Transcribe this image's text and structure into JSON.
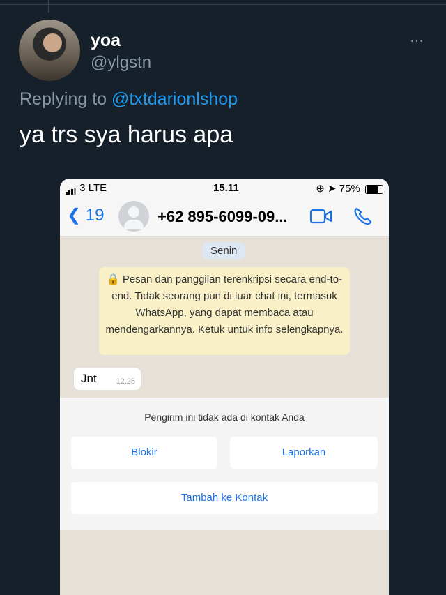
{
  "tweet": {
    "display_name": "yoa",
    "handle": "@ylgstn",
    "more_icon": "⋯",
    "replying_prefix": "Replying to",
    "replying_to": "@txtdarionlshop",
    "text": "ya trs sya harus apa"
  },
  "screenshot": {
    "status_bar": {
      "carrier": "3",
      "network": "LTE",
      "time": "15.11",
      "battery": "75%"
    },
    "header": {
      "back_count": "19",
      "contact": "+62 895-6099-09..."
    },
    "chat": {
      "day_label": "Senin",
      "encryption_notice": "Pesan dan panggilan terenkripsi secara end-to-end. Tidak seorang pun di luar chat ini, termasuk WhatsApp, yang dapat membaca atau mendengarkannya. Ketuk untuk info selengkapnya.",
      "message": {
        "text": "Jnt",
        "time": "12.25"
      }
    },
    "unknown_sender": {
      "label": "Pengirim ini tidak ada di kontak Anda",
      "block": "Blokir",
      "report": "Laporkan",
      "add_contact": "Tambah ke Kontak"
    }
  },
  "colors": {
    "background": "#15202b",
    "link": "#1d9bf0",
    "whatsapp_blue": "#1a73e8",
    "notice": "#f9f0c8"
  }
}
